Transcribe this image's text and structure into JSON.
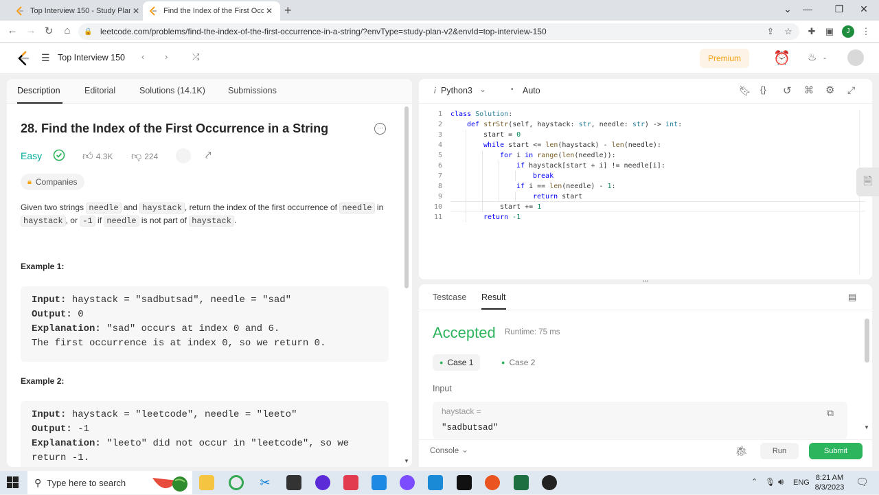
{
  "browser": {
    "tabs": [
      {
        "title": "Top Interview 150 - Study Plan -",
        "active": false
      },
      {
        "title": "Find the Index of the First Occurr",
        "active": true
      }
    ],
    "url": "leetcode.com/problems/find-the-index-of-the-first-occurrence-in-a-string/?envType=study-plan-v2&envId=top-interview-150",
    "profile_initial": "J"
  },
  "header": {
    "study_plan": "Top Interview 150",
    "premium": "Premium",
    "streak": "-"
  },
  "left": {
    "tabs": [
      "Description",
      "Editorial",
      "Solutions (14.1K)",
      "Submissions"
    ],
    "title": "28. Find the Index of the First Occurrence in a String",
    "difficulty": "Easy",
    "likes": "4.3K",
    "dislikes": "224",
    "companies": "Companies",
    "statement": {
      "p1": "Given two strings ",
      "c1": "needle",
      "p2": " and ",
      "c2": "haystack",
      "p3": ", return the index of the first occurrence of ",
      "c3": "needle",
      "p4": " in ",
      "c4": "haystack",
      "p5": ", or ",
      "c5": "-1",
      "p6": " if ",
      "c6": "needle",
      "p7": " is not part of ",
      "c7": "haystack",
      "p8": "."
    },
    "example1": {
      "label": "Example 1:",
      "input_label": "Input:",
      "input": " haystack = \"sadbutsad\", needle = \"sad\"",
      "output_label": "Output:",
      "output": " 0",
      "explanation_label": "Explanation:",
      "explanation1": " \"sad\" occurs at index 0 and 6.",
      "explanation2": "The first occurrence is at index 0, so we return 0."
    },
    "example2": {
      "label": "Example 2:",
      "input_label": "Input:",
      "input": " haystack = \"leetcode\", needle = \"leeto\"",
      "output_label": "Output:",
      "output": " -1",
      "explanation_label": "Explanation:",
      "explanation1": " \"leeto\" did not occur in \"leetcode\", so we",
      "explanation2": "return -1."
    }
  },
  "editor": {
    "language": "Python3",
    "mode": "Auto",
    "lines": [
      {
        "n": "1",
        "indent": 0,
        "parts": [
          [
            "kw",
            "class "
          ],
          [
            "ty",
            "Solution"
          ],
          [
            "",
            ":"
          ]
        ]
      },
      {
        "n": "2",
        "indent": 1,
        "parts": [
          [
            "kw",
            "def "
          ],
          [
            "fn",
            "strStr"
          ],
          [
            "",
            "(self, haystack: "
          ],
          [
            "ty",
            "str"
          ],
          [
            "",
            ", needle: "
          ],
          [
            "ty",
            "str"
          ],
          [
            "",
            ") -> "
          ],
          [
            "ty",
            "int"
          ],
          [
            "",
            ":"
          ]
        ]
      },
      {
        "n": "3",
        "indent": 2,
        "parts": [
          [
            "",
            "start = "
          ],
          [
            "nm",
            "0"
          ]
        ]
      },
      {
        "n": "4",
        "indent": 2,
        "parts": [
          [
            "kw",
            "while "
          ],
          [
            "",
            "start <= "
          ],
          [
            "fn",
            "len"
          ],
          [
            "",
            "(haystack) - "
          ],
          [
            "fn",
            "len"
          ],
          [
            "",
            "(needle):"
          ]
        ]
      },
      {
        "n": "5",
        "indent": 3,
        "parts": [
          [
            "kw",
            "for "
          ],
          [
            "",
            "i "
          ],
          [
            "kw",
            "in "
          ],
          [
            "fn",
            "range"
          ],
          [
            "",
            "("
          ],
          [
            "fn",
            "len"
          ],
          [
            "",
            "(needle)):"
          ]
        ]
      },
      {
        "n": "6",
        "indent": 4,
        "parts": [
          [
            "kw",
            "if "
          ],
          [
            "",
            "haystack[start + i] != needle[i]:"
          ]
        ]
      },
      {
        "n": "7",
        "indent": 5,
        "parts": [
          [
            "kw",
            "break"
          ]
        ]
      },
      {
        "n": "8",
        "indent": 4,
        "parts": [
          [
            "kw",
            "if "
          ],
          [
            "",
            "i == "
          ],
          [
            "fn",
            "len"
          ],
          [
            "",
            "(needle) - "
          ],
          [
            "nm",
            "1"
          ],
          [
            "",
            ":"
          ]
        ]
      },
      {
        "n": "9",
        "indent": 5,
        "parts": [
          [
            "kw",
            "return "
          ],
          [
            "",
            "start"
          ]
        ]
      },
      {
        "n": "10",
        "indent": 3,
        "parts": [
          [
            "",
            "start += "
          ],
          [
            "nm",
            "1"
          ]
        ]
      },
      {
        "n": "11",
        "indent": 2,
        "parts": [
          [
            "kw",
            "return "
          ],
          [
            "nm",
            "-1"
          ]
        ]
      }
    ]
  },
  "result": {
    "tabs": [
      "Testcase",
      "Result"
    ],
    "status": "Accepted",
    "runtime": "Runtime: 75 ms",
    "cases": [
      "Case 1",
      "Case 2"
    ],
    "input_label": "Input",
    "var_name": "haystack =",
    "var_value": "\"sadbutsad\"",
    "console": "Console",
    "run": "Run",
    "submit": "Submit"
  },
  "taskbar": {
    "search_placeholder": "Type here to search",
    "language": "ENG",
    "time": "8:21 AM",
    "date": "8/3/2023"
  }
}
